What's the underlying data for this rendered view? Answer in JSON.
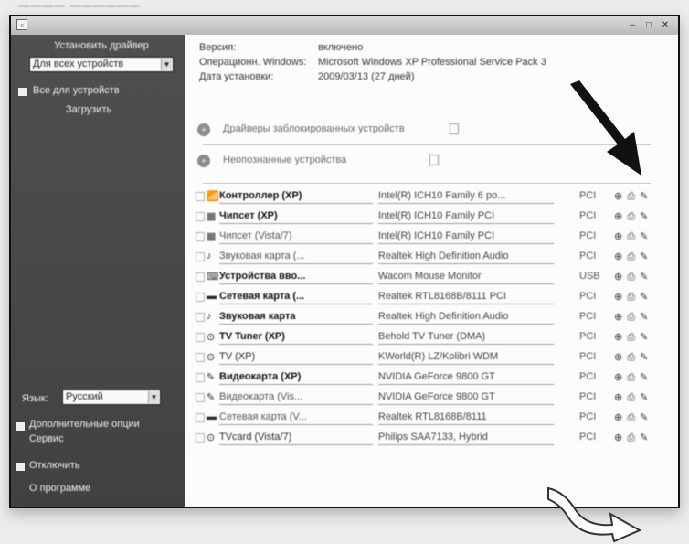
{
  "caption": "———— ——————",
  "window": {
    "icon": "app-window-icon",
    "controls": [
      "–",
      "□",
      "✕"
    ]
  },
  "sidebar": {
    "top_label": "Установить драйвер",
    "top_select": "Для всех устройств",
    "checkbox_label": "Все для устройств",
    "sub_label": "Загрузить",
    "bottom_select_label": "Язык:",
    "bottom_select_value": "Русский",
    "links": [
      "Дополнительные опции",
      "Отключить",
      "О программе"
    ],
    "links_extra": "Сервис"
  },
  "info": {
    "rows": [
      {
        "label": "Версия:",
        "value": "включено"
      },
      {
        "label": "Операционн. Windows:",
        "value": "Microsoft Windows XP Professional Service Pack 3"
      },
      {
        "label": "Дата установки:",
        "value": "2009/03/13 (27 дней)"
      }
    ]
  },
  "tools": [
    {
      "label": "Драйверы заблокированных устройств",
      "icon": "plus-circle-icon"
    },
    {
      "label": "Неопознанные устройства",
      "icon": "plus-circle-icon"
    }
  ],
  "devices": [
    {
      "icon": "📶",
      "name": "Контроллер (XP)",
      "model": "Intel(R) ICH10 Family 6 po...",
      "bus": "PCI",
      "style": "bold"
    },
    {
      "icon": "▦",
      "name": "Чипсет (XP)",
      "model": "Intel(R) ICH10 Family PCI",
      "bus": "PCI",
      "style": "bold"
    },
    {
      "icon": "▦",
      "name": "Чипсет (Vista/7)",
      "model": "Intel(R) ICH10 Family PCI",
      "bus": "PCI",
      "style": "light"
    },
    {
      "icon": "♪",
      "name": "Звуковая карта (...",
      "model": "Realtek High Definition Audio",
      "bus": "PCI",
      "style": "light"
    },
    {
      "icon": "⌨",
      "name": "Устройства вво...",
      "model": "Wacom Mouse Monitor",
      "bus": "USB",
      "style": "bold"
    },
    {
      "icon": "▬",
      "name": "Сетевая карта (...",
      "model": "Realtek RTL8168B/8111 PCI",
      "bus": "PCI",
      "style": "bold"
    },
    {
      "icon": "♪",
      "name": "Звуковая карта",
      "model": "Realtek High Definition Audio",
      "bus": "PCI",
      "style": "bold"
    },
    {
      "icon": "⊙",
      "name": "TV Tuner (XP)",
      "model": "Behold TV Tuner (DMA)",
      "bus": "PCI",
      "style": "bold"
    },
    {
      "icon": "⊙",
      "name": "TV (XP)",
      "model": "KWorld(R) LZ/Kolibri WDM",
      "bus": "PCI",
      "style": "normal"
    },
    {
      "icon": "✎",
      "name": "Видеокарта (XP)",
      "model": "NVIDIA GeForce 9800 GT",
      "bus": "PCI",
      "style": "bold"
    },
    {
      "icon": "✎",
      "name": "Видеокарта (Vis...",
      "model": "NVIDIA GeForce 9800 GT",
      "bus": "PCI",
      "style": "light"
    },
    {
      "icon": "▬",
      "name": "Сетевая карта (V...",
      "model": "Realtek RTL8168B/8111",
      "bus": "PCI",
      "style": "light"
    },
    {
      "icon": "⊙",
      "name": "TVcard (Vista/7)",
      "model": "Philips SAA7133, Hybrid",
      "bus": "PCI",
      "style": "normal"
    }
  ],
  "actions": {
    "info": "⊕",
    "install": "⎙",
    "download": "✎"
  }
}
